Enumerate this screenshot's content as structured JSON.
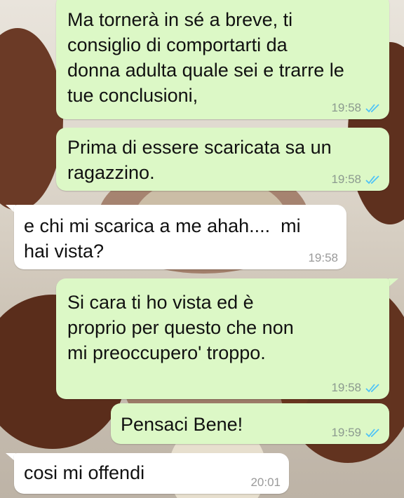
{
  "messages": [
    {
      "direction": "out",
      "text": "Ma tornerà in sé a breve, ti\nconsiglio di comportarti da\ndonna adulta quale sei e trarre le\ntue conclusioni,",
      "time": "19:58",
      "status": "read"
    },
    {
      "direction": "out",
      "text": "Prima di essere scaricata sa un\nragazzino.",
      "time": "19:58",
      "status": "read"
    },
    {
      "direction": "in",
      "text": "e chi mi scarica a me ahah....  mi\nhai vista?",
      "time": "19:58"
    },
    {
      "direction": "out",
      "text": "Si cara ti ho vista ed è\nproprio per questo che non\nmi preoccupero' troppo.",
      "time": "19:58",
      "status": "read"
    },
    {
      "direction": "out",
      "text": "Pensaci Bene!",
      "time": "19:59",
      "status": "read"
    },
    {
      "direction": "in",
      "text": "cosi mi offendi",
      "time": "20:01"
    }
  ],
  "colors": {
    "outgoing_bubble": "#dcf8c6",
    "incoming_bubble": "#ffffff",
    "read_ticks": "#4fc3f7"
  },
  "icons": {
    "read_receipt": "double-check-icon"
  }
}
